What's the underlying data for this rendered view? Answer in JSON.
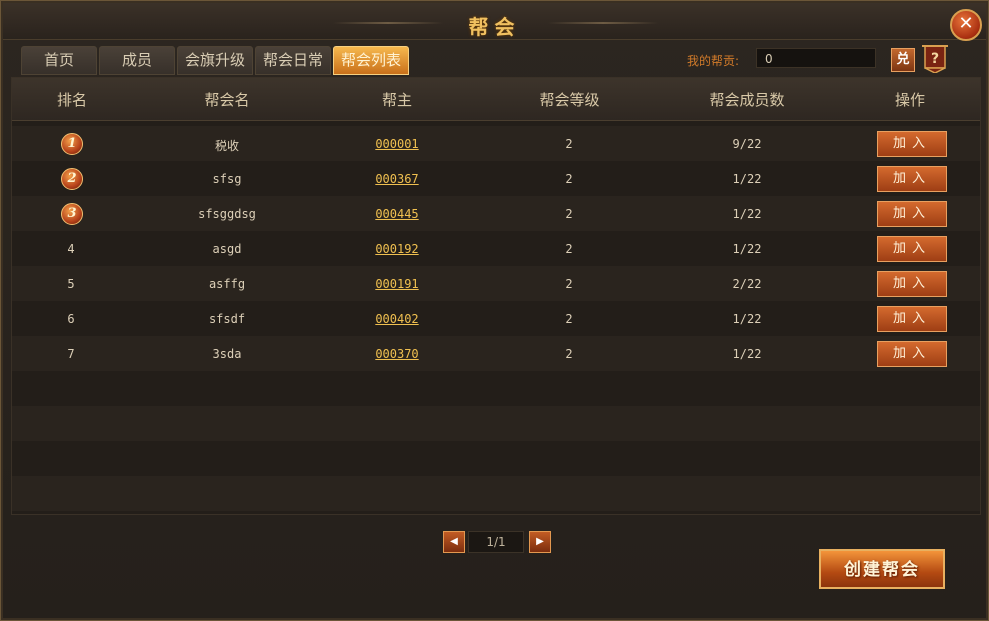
{
  "window": {
    "title": "帮会"
  },
  "tabs": [
    {
      "label": "首页",
      "active": false
    },
    {
      "label": "成员",
      "active": false
    },
    {
      "label": "会旗升级",
      "active": false
    },
    {
      "label": "帮会日常",
      "active": false
    },
    {
      "label": "帮会列表",
      "active": true
    }
  ],
  "contribution": {
    "label": "我的帮贡:",
    "value": "0",
    "redeem_label": "兑"
  },
  "table": {
    "headers": [
      "排名",
      "帮会名",
      "帮主",
      "帮会等级",
      "帮会成员数",
      "操作"
    ],
    "rows": [
      {
        "rank": "1",
        "name": "税收",
        "leader": "000001",
        "level": "2",
        "members": "9/22",
        "action": "加入"
      },
      {
        "rank": "2",
        "name": "sfsg",
        "leader": "000367",
        "level": "2",
        "members": "1/22",
        "action": "加入"
      },
      {
        "rank": "3",
        "name": "sfsggdsg",
        "leader": "000445",
        "level": "2",
        "members": "1/22",
        "action": "加入"
      },
      {
        "rank": "4",
        "name": "asgd",
        "leader": "000192",
        "level": "2",
        "members": "1/22",
        "action": "加入"
      },
      {
        "rank": "5",
        "name": "asffg",
        "leader": "000191",
        "level": "2",
        "members": "2/22",
        "action": "加入"
      },
      {
        "rank": "6",
        "name": "sfsdf",
        "leader": "000402",
        "level": "2",
        "members": "1/22",
        "action": "加入"
      },
      {
        "rank": "7",
        "name": "3sda",
        "leader": "000370",
        "level": "2",
        "members": "1/22",
        "action": "加入"
      }
    ]
  },
  "pagination": {
    "page": "1/1",
    "prev_icon": "arrow-left-icon",
    "next_icon": "arrow-right-icon"
  },
  "create_button": {
    "label": "创建帮会"
  },
  "colors": {
    "accent": "#f0c050",
    "button": "#c25c24",
    "title": "#f0c060"
  }
}
